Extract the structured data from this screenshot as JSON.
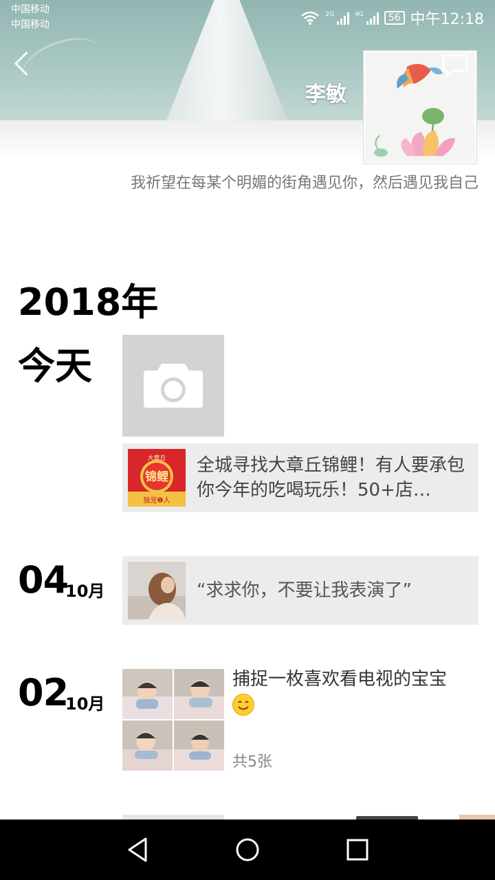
{
  "status_bar": {
    "carrier_1": "中国移动",
    "carrier_2": "中国移动",
    "net_1": "2G",
    "net_2": "4G",
    "battery": "56",
    "time": "中午12:18"
  },
  "header": {
    "back_icon": "chevron-left-icon",
    "name": "李敏",
    "message_icon": "chat-bubble-icon",
    "avatar_desc": "lotus-painting-avatar"
  },
  "signature": "我祈望在每某个明媚的街角遇见你，然后遇见我自己",
  "timeline": {
    "year": "2018年",
    "today_label": "今天",
    "camera_icon": "camera-icon",
    "entries": [
      {
        "text": "全城寻找大章丘锦鲤！有人要承包你今年的吃喝玩乐！50+店…",
        "thumb_top": "大章丘",
        "thumb_main": "锦鲤",
        "thumb_bottom": "独宠❶人"
      },
      {
        "day": "04",
        "month": "10月",
        "text": "“求求你，不要让我表演了”"
      },
      {
        "day": "02",
        "month": "10月",
        "text": "捕捉一枚喜欢看电视的宝宝",
        "count": "共5张"
      }
    ]
  },
  "nav_bar": {
    "back": "triangle-back-icon",
    "home": "circle-home-icon",
    "recent": "square-recent-icon"
  },
  "colors": {
    "cover": "#a9c8c4",
    "card_bg": "#ececec",
    "placeholder": "#d3d3d3",
    "nav": "#000000"
  }
}
